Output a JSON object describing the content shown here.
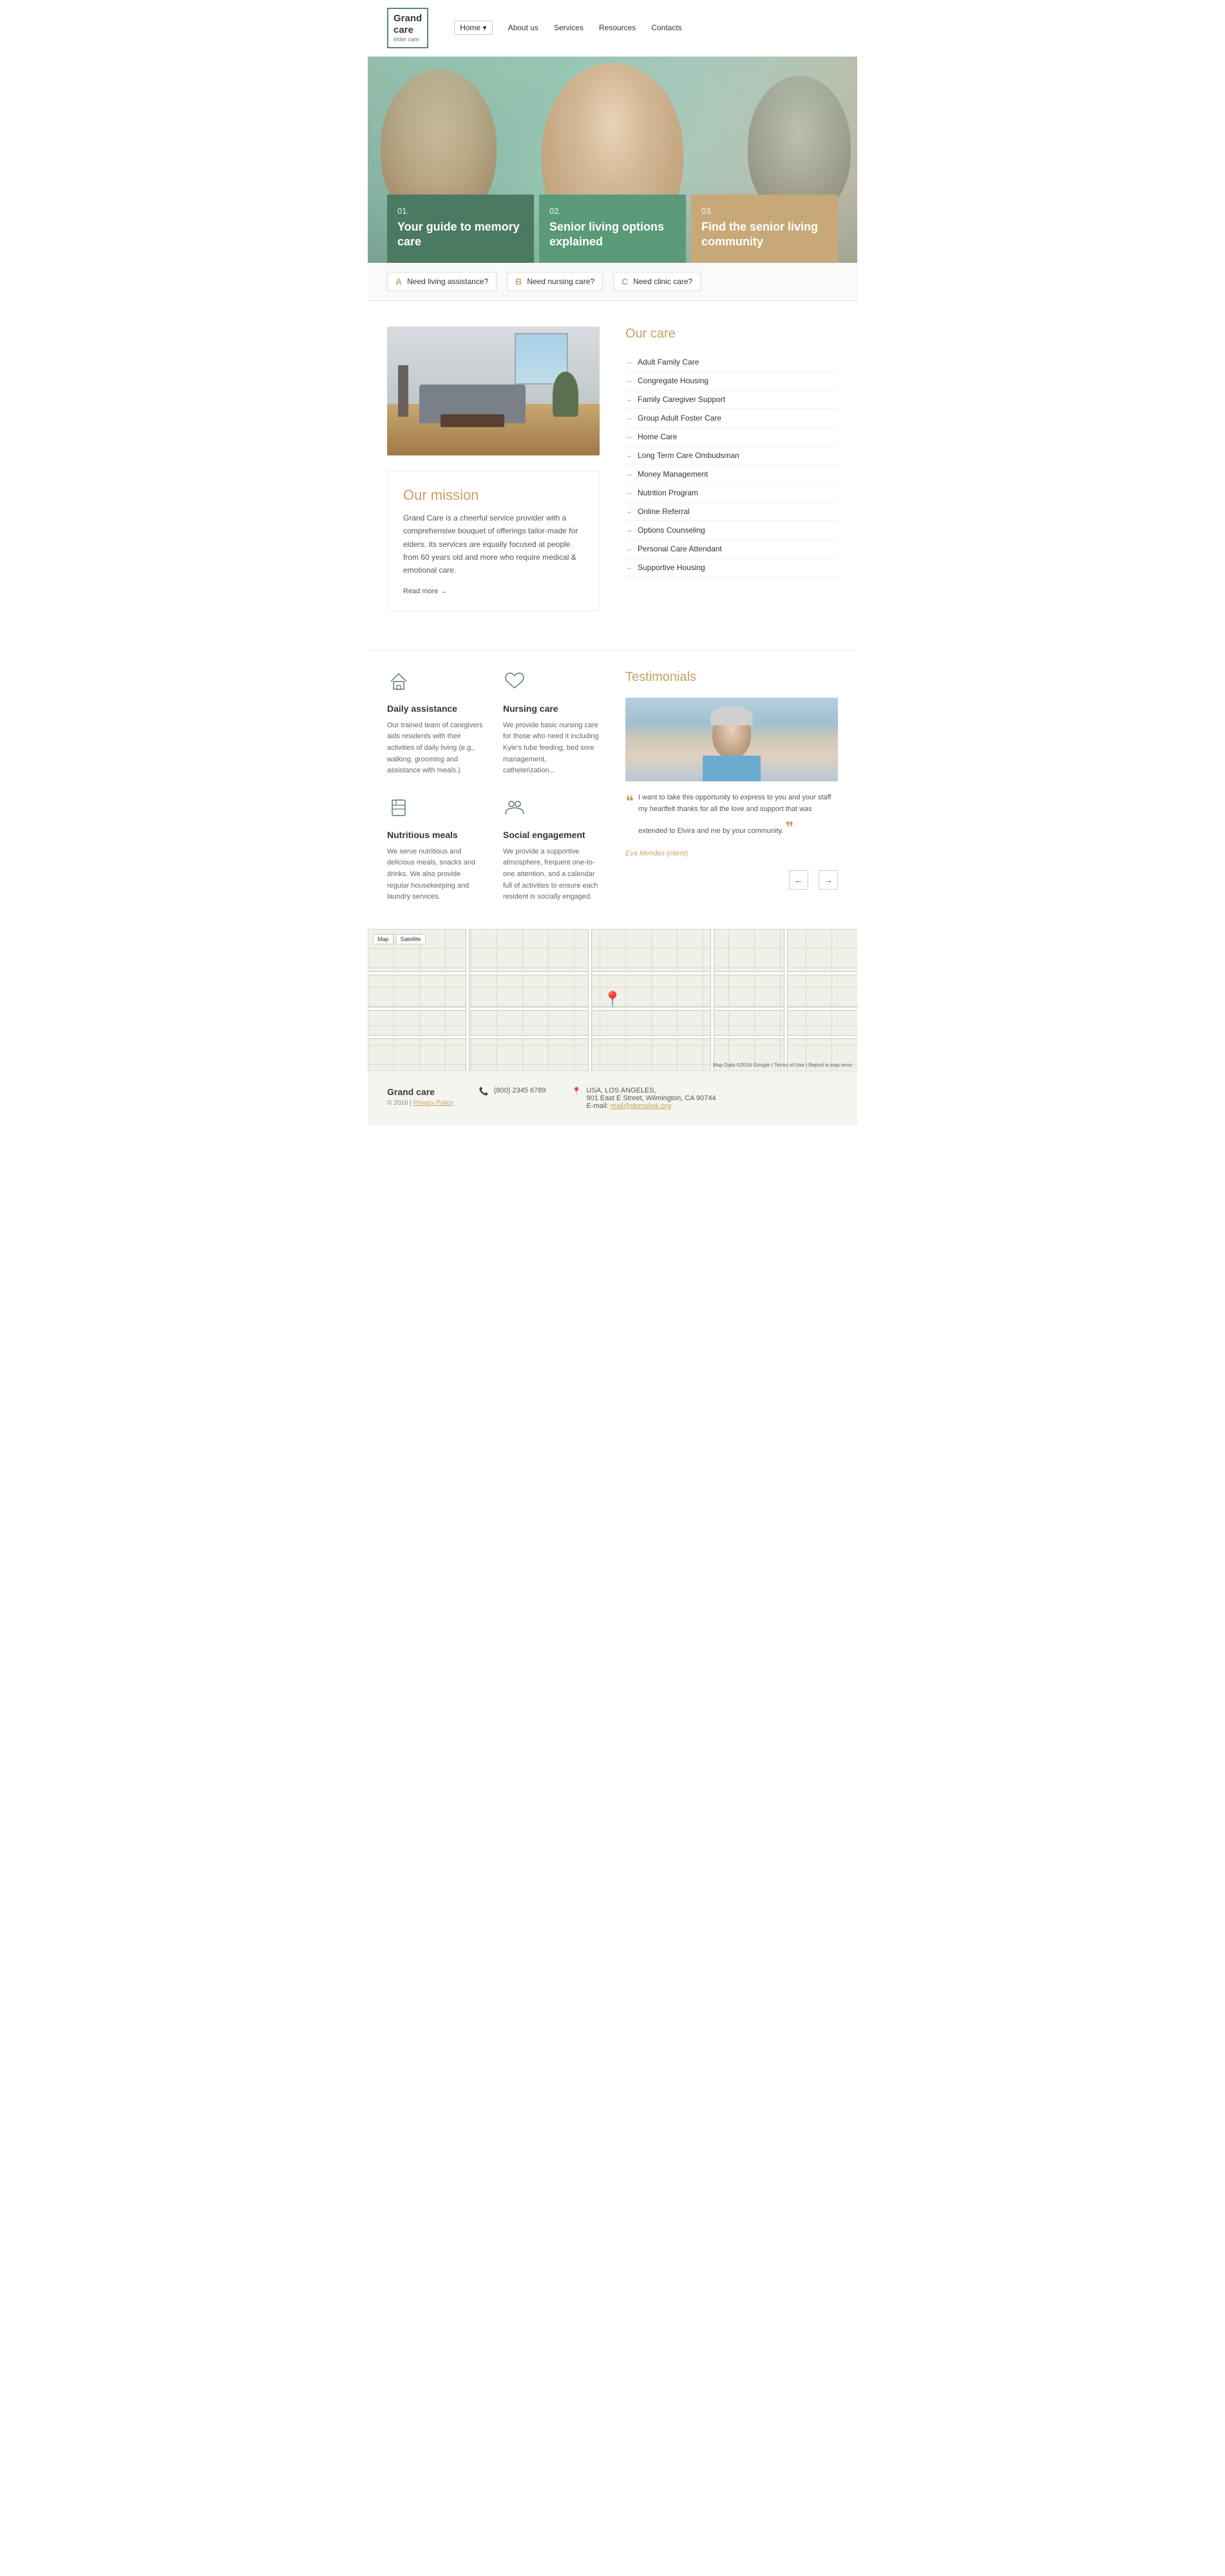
{
  "brand": {
    "name_line1": "Grand",
    "name_line2": "care",
    "tagline": "elder care"
  },
  "nav": {
    "links": [
      {
        "label": "Home",
        "active": true,
        "dropdown": true
      },
      {
        "label": "About us",
        "active": false
      },
      {
        "label": "Services",
        "active": false
      },
      {
        "label": "Resources",
        "active": false
      },
      {
        "label": "Contacts",
        "active": false
      }
    ]
  },
  "hero": {
    "cards": [
      {
        "num": "01.",
        "title": "Your guide to memory care"
      },
      {
        "num": "02.",
        "title": "Senior living options explained"
      },
      {
        "num": "03.",
        "title": "Find the senior living community"
      }
    ]
  },
  "tabs": [
    {
      "letter": "A",
      "label": "Need living assistance?"
    },
    {
      "letter": "B",
      "label": "Need nursing care?"
    },
    {
      "letter": "C",
      "label": "Need clinic care?"
    }
  ],
  "our_care": {
    "title": "Our care",
    "items": [
      "Adult Family Care",
      "Congregate Housing",
      "Family Caregiver Support",
      "Group Adult Foster Care",
      "Home Care",
      "Long Term Care Ombudsman",
      "Money Management",
      "Nutrition Program",
      "Online Referral",
      "Options Counseling",
      "Personal Care Attendant",
      "Supportive Housing"
    ]
  },
  "mission": {
    "title": "Our mission",
    "text": "Grand Care is a cheerful service provider with a comprehensive bouquet of offerings tailor-made for elders. Its services are equally focused at people from 60 years old and more who require medical & emotional care.",
    "read_more": "Read more →"
  },
  "services": [
    {
      "icon": "home",
      "title": "Daily assistance",
      "text": "Our trained team of caregivers aids residents with their activities of daily living (e.g., walking, grooming and assistance with meals.)"
    },
    {
      "icon": "heart",
      "title": "Nursing care",
      "text": "We provide basic nursing care for those who need it including Kyle's tube feeding, bed sore management, catheterization..."
    },
    {
      "icon": "food",
      "title": "Nutritious meals",
      "text": "We serve nutritious and delicious meals, snacks and drinks. We also provide regular housekeeping and laundry services."
    },
    {
      "icon": "people",
      "title": "Social engagement",
      "text": "We provide a supportive atmosphere, frequent one-to-one attention, and a calendar full of activities to ensure each resident is socially engaged."
    }
  ],
  "testimonials": {
    "title": "Testimonials",
    "quote": "I want to take this opportunity to express to you and your staff my heartfelt thanks for all the love and support that was extended to Elvira and me by your community.",
    "author": "Eva Mendes (client)"
  },
  "footer": {
    "brand": "Grand care",
    "year": "© 2016",
    "privacy": "Privacy Policy",
    "phone": "(800) 2345 6789",
    "address_line1": "USA, LOS ANGELES,",
    "address_line2": "901 East E Street, Wilmington, CA 90744",
    "email": "mail@demolink.org"
  }
}
